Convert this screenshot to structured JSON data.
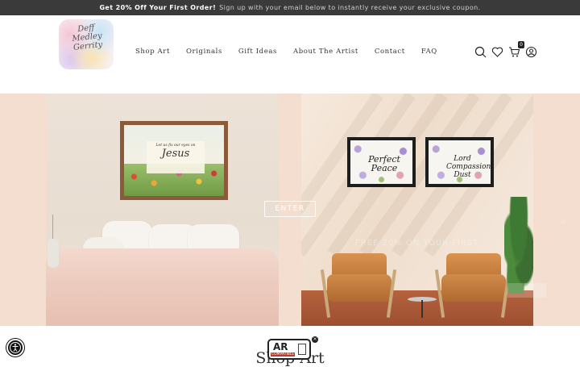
{
  "announcement": {
    "bold": "Get 20% Off Your First Order!",
    "rest": "Sign up with your email below to instantly receive your exclusive coupon."
  },
  "logo": {
    "text": "Deff Medley Gerrity"
  },
  "nav": [
    {
      "label": "Shop Art"
    },
    {
      "label": "Originals"
    },
    {
      "label": "Gift Ideas"
    },
    {
      "label": "About The Artist"
    },
    {
      "label": "Contact"
    },
    {
      "label": "FAQ"
    }
  ],
  "header_icons": {
    "search": "search-icon",
    "wishlist": "heart-icon",
    "cart": "cart-icon",
    "cart_count": "0",
    "account": "user-icon"
  },
  "hero": {
    "enter_label": "ENTER",
    "big_frame_small_text": "Let us fix our eyes on",
    "big_frame_word": "Jesus",
    "frame_left_word": "Perfect Peace",
    "frame_right_word": "Lord Compassion Dust",
    "ghost_title": "FREE 20% ON YOUR FIRST",
    "ghost_close": "×"
  },
  "section": {
    "title": "Shop Art"
  },
  "ar_badge": {
    "label": "AR",
    "tag": "COMPATIBLE",
    "close": "×"
  }
}
